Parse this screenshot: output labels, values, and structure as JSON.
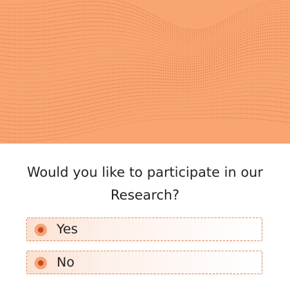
{
  "hero": {
    "background_color": "#f8a572",
    "pattern_color": "#c9622c",
    "pattern": "dotted-wave-surface"
  },
  "survey": {
    "question": "Would you like to participate in our Research?",
    "options": [
      {
        "label": "Yes",
        "selected": true
      },
      {
        "label": "No",
        "selected": false
      }
    ]
  },
  "colors": {
    "accent": "#f6a27a",
    "radio_center": "#c74a1a",
    "option_border": "#e0916a"
  }
}
